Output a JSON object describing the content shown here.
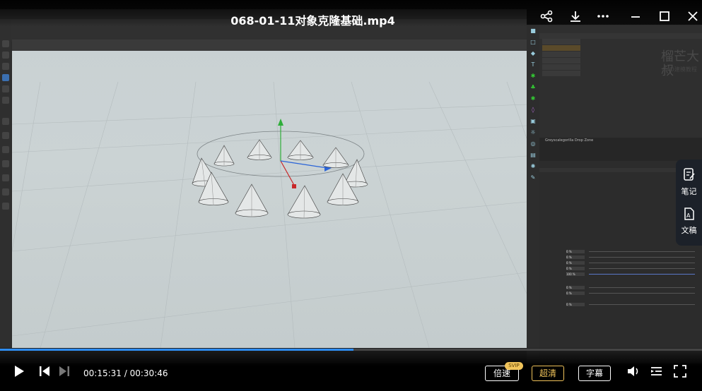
{
  "player": {
    "title": "068-01-11对象克隆基础.mp4",
    "time_current": "00:15:31",
    "time_total": "00:30:46",
    "time_separator": "/",
    "progress": 0.504,
    "speed_label": "倍速",
    "speed_badge": "SVIP",
    "quality_label": "超清",
    "subtitle_label": "字幕",
    "icons": [
      "share-icon",
      "download-icon",
      "more-icon",
      "minimize-icon",
      "maximize-icon",
      "close-icon",
      "play-icon",
      "previous-icon",
      "next-icon",
      "volume-icon",
      "playlist-icon",
      "fullscreen-icon"
    ],
    "accent_color": "#2e8cf0"
  },
  "side_panel": {
    "notes_label": "笔记",
    "doc_label": "文稿"
  },
  "c4d": {
    "watermark_title": "榴芒大叔",
    "watermark_sub": "C4D建模教程",
    "drop_zone": "Greyscalegorilla Drop Zone",
    "attr_value_0": "0 %",
    "attr_value_100": "100 %"
  }
}
